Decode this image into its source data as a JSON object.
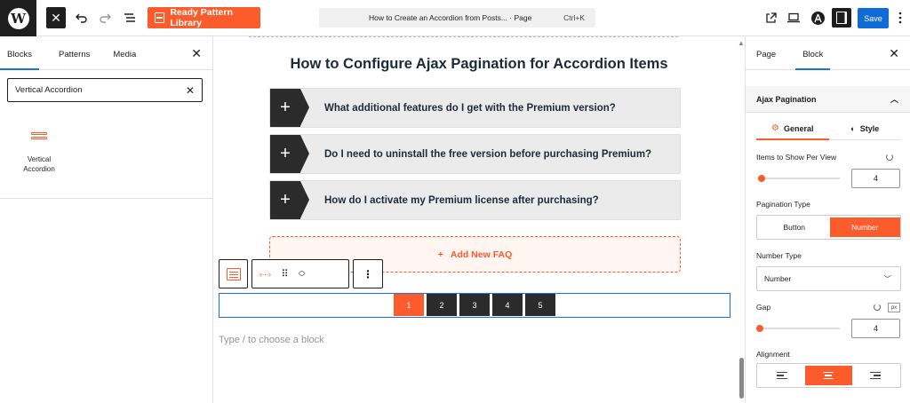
{
  "topbar": {
    "ready_btn_label": "Ready Pattern Library",
    "doc_title": "How to Create an Accordion from Posts... · Page",
    "doc_shortcut": "Ctrl+K",
    "save_label": "Save"
  },
  "left_panel": {
    "tabs": [
      "Blocks",
      "Patterns",
      "Media"
    ],
    "search_value": "Vertical Accordion",
    "result_label": "Vertical Accordion"
  },
  "canvas": {
    "title": "How to Configure Ajax Pagination for Accordion Items",
    "items": [
      {
        "question": "What additional features do I get with the Premium version?"
      },
      {
        "question": "Do I need to uninstall the free version before purchasing Premium?"
      },
      {
        "question": "How do I activate my Premium license after purchasing?"
      }
    ],
    "add_faq_label": "Add New FAQ",
    "pages": [
      "1",
      "2",
      "3",
      "4",
      "5"
    ],
    "active_page": "1",
    "type_hint": "Type / to choose a block"
  },
  "right_panel": {
    "tabs": [
      "Page",
      "Block"
    ],
    "section_title": "Ajax Pagination",
    "subtabs": [
      "General",
      "Style"
    ],
    "items_label": "Items to Show Per View",
    "items_value": "4",
    "pagination_type_label": "Pagination Type",
    "pagination_options": [
      "Button",
      "Number"
    ],
    "pagination_selected": "Number",
    "number_type_label": "Number Type",
    "number_type_value": "Number",
    "gap_label": "Gap",
    "gap_unit": "px",
    "gap_value": "4",
    "alignment_label": "Alignment"
  },
  "colors": {
    "accent": "#fc5b2b",
    "save": "#0f6bd7",
    "dark": "#1e1e1e"
  }
}
